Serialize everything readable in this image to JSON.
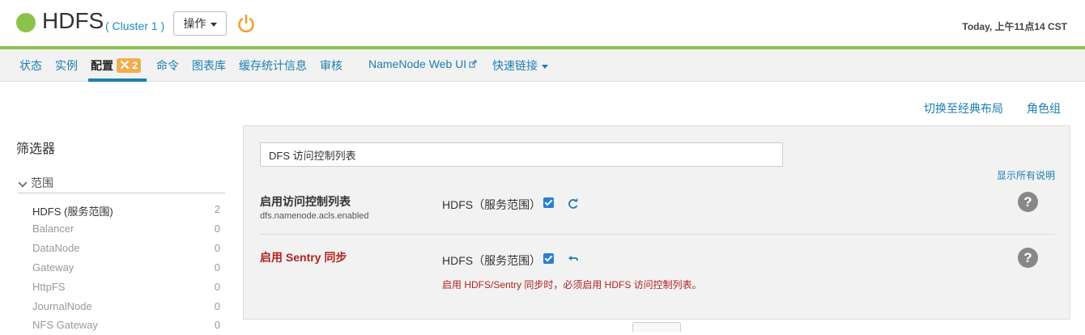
{
  "header": {
    "title": "HDFS",
    "cluster": "( Cluster 1 )",
    "actions_label": "操作",
    "timestamp": "Today, 上午11点14 CST"
  },
  "nav": {
    "items": [
      {
        "label": "状态"
      },
      {
        "label": "实例"
      },
      {
        "label": "配置",
        "badge": "2"
      },
      {
        "label": "命令"
      },
      {
        "label": "图表库"
      },
      {
        "label": "缓存统计信息"
      },
      {
        "label": "审核"
      },
      {
        "label": "NameNode Web UI"
      },
      {
        "label": "快速链接"
      }
    ]
  },
  "links": {
    "classic_layout": "切换至经典布局",
    "role_groups": "角色组"
  },
  "filters": {
    "title": "筛选器",
    "scope_label": "范围",
    "scope_items": [
      {
        "label": "HDFS (服务范围)",
        "count": "2"
      },
      {
        "label": "Balancer",
        "count": "0"
      },
      {
        "label": "DataNode",
        "count": "0"
      },
      {
        "label": "Gateway",
        "count": "0"
      },
      {
        "label": "HttpFS",
        "count": "0"
      },
      {
        "label": "JournalNode",
        "count": "0"
      },
      {
        "label": "NFS Gateway",
        "count": "0"
      }
    ]
  },
  "config": {
    "search_value": "DFS 访问控制列表",
    "show_all_descriptions": "显示所有说明",
    "properties": [
      {
        "name": "启用访问控制列表",
        "key": "dfs.namenode.acls.enabled",
        "scope": "HDFS（服务范围）",
        "checked": true,
        "status": "normal"
      },
      {
        "name": "启用 Sentry 同步",
        "key": "",
        "scope": "HDFS（服务范围）",
        "checked": true,
        "status": "error",
        "message": "启用 HDFS/Sentry 同步时，必须启用 HDFS 访问控制列表。"
      }
    ]
  },
  "colors": {
    "status_green": "#8bc34a",
    "link_blue": "#1b7fb0",
    "error_red": "#b22222",
    "badge_orange": "#f0ad4e"
  }
}
